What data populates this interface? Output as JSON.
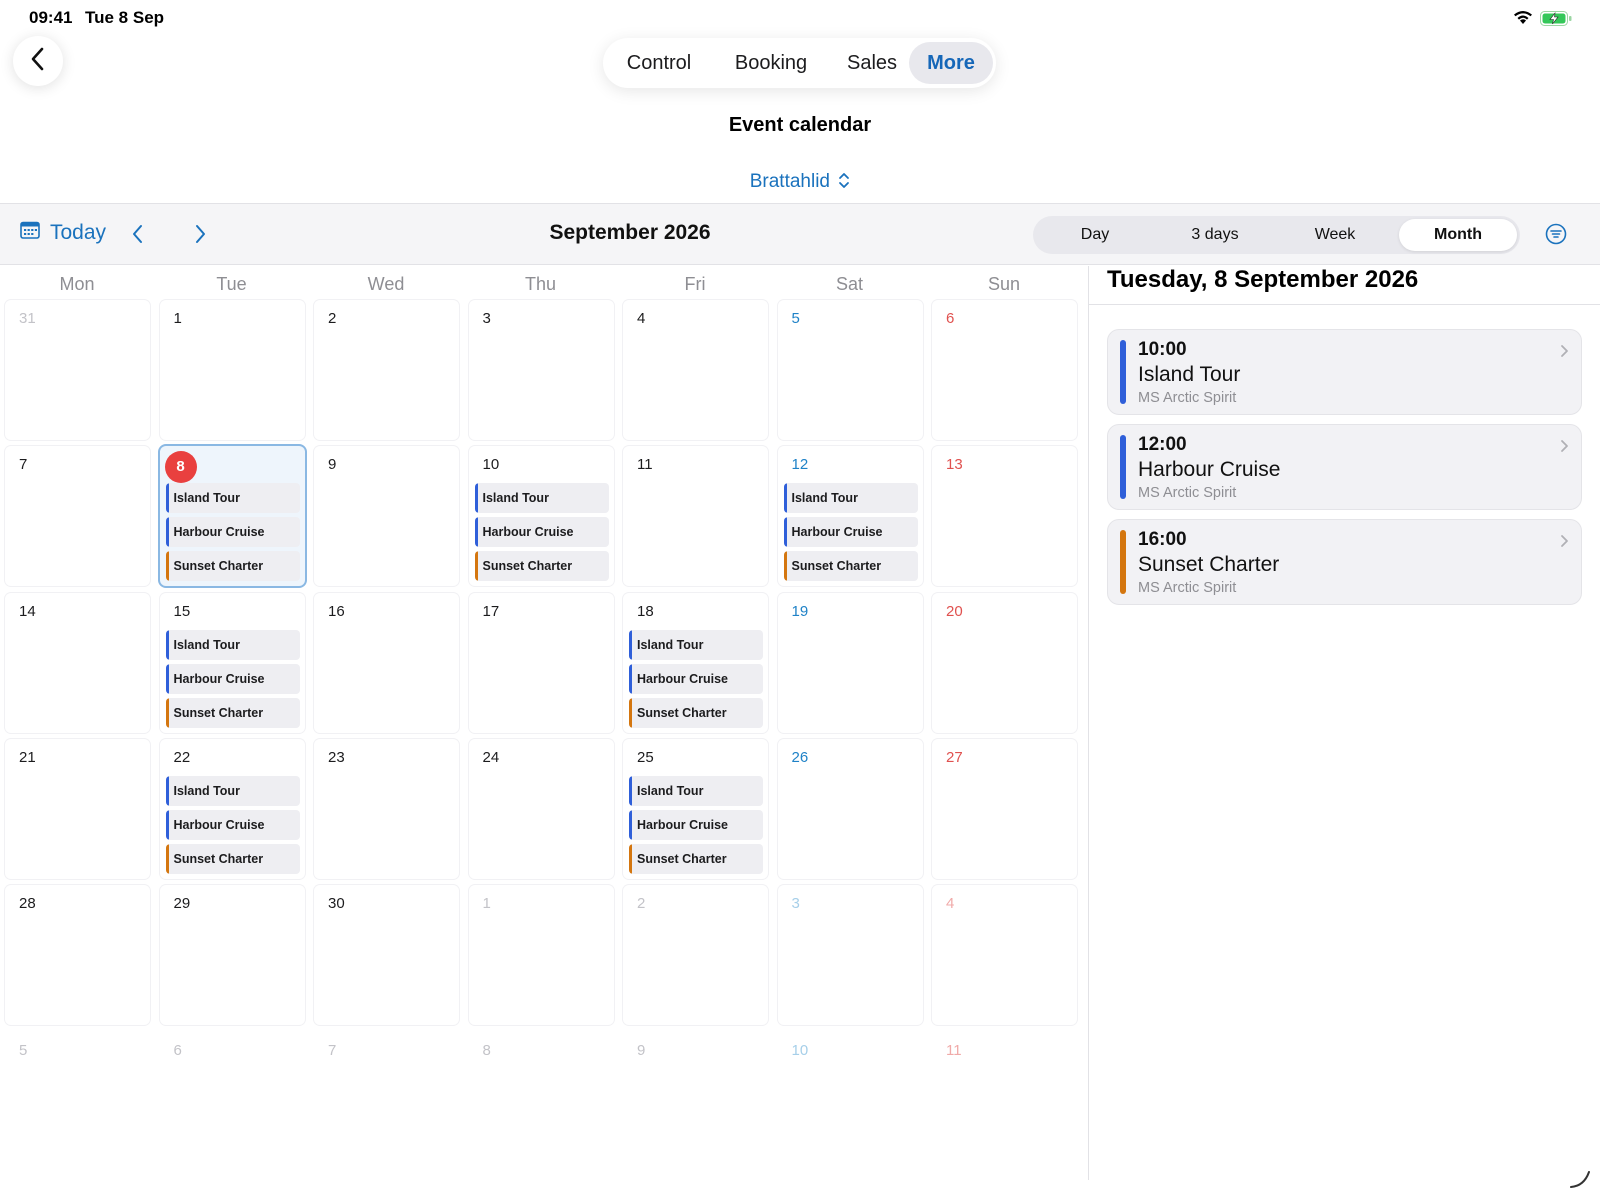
{
  "status_bar": {
    "time": "09:41",
    "date": "Tue 8 Sep",
    "wifi_icon": "wifi-icon",
    "battery_icon": "battery-charging-icon"
  },
  "header": {
    "back_icon": "chevron-left-icon",
    "tabs": [
      {
        "label": "Control",
        "active": false
      },
      {
        "label": "Booking",
        "active": false
      },
      {
        "label": "Sales",
        "active": false
      },
      {
        "label": "More",
        "active": true
      }
    ],
    "page_title": "Event calendar",
    "location": "Brattahlid",
    "location_icon": "chevron-up-down-icon"
  },
  "toolbar": {
    "today_label": "Today",
    "today_icon": "calendar-icon",
    "month_label": "September 2026",
    "views": [
      {
        "label": "Day",
        "active": false
      },
      {
        "label": "3 days",
        "active": false
      },
      {
        "label": "Week",
        "active": false
      },
      {
        "label": "Month",
        "active": true
      }
    ],
    "filter_icon": "filter-icon"
  },
  "calendar": {
    "weekdays": [
      "Mon",
      "Tue",
      "Wed",
      "Thu",
      "Fri",
      "Sat",
      "Sun"
    ],
    "weeks": [
      [
        {
          "day": "31",
          "dim": true,
          "events": []
        },
        {
          "day": "1",
          "events": []
        },
        {
          "day": "2",
          "events": []
        },
        {
          "day": "3",
          "events": []
        },
        {
          "day": "4",
          "events": []
        },
        {
          "day": "5",
          "events": []
        },
        {
          "day": "6",
          "events": []
        }
      ],
      [
        {
          "day": "7",
          "events": []
        },
        {
          "day": "8",
          "today": true,
          "events": [
            "Island Tour",
            "Harbour Cruise",
            "Sunset Charter"
          ]
        },
        {
          "day": "9",
          "events": []
        },
        {
          "day": "10",
          "events": [
            "Island Tour",
            "Harbour Cruise",
            "Sunset Charter"
          ]
        },
        {
          "day": "11",
          "events": []
        },
        {
          "day": "12",
          "events": [
            "Island Tour",
            "Harbour Cruise",
            "Sunset Charter"
          ]
        },
        {
          "day": "13",
          "events": []
        }
      ],
      [
        {
          "day": "14",
          "events": []
        },
        {
          "day": "15",
          "events": [
            "Island Tour",
            "Harbour Cruise",
            "Sunset Charter"
          ]
        },
        {
          "day": "16",
          "events": []
        },
        {
          "day": "17",
          "events": []
        },
        {
          "day": "18",
          "events": [
            "Island Tour",
            "Harbour Cruise",
            "Sunset Charter"
          ]
        },
        {
          "day": "19",
          "events": []
        },
        {
          "day": "20",
          "events": []
        }
      ],
      [
        {
          "day": "21",
          "events": []
        },
        {
          "day": "22",
          "events": [
            "Island Tour",
            "Harbour Cruise",
            "Sunset Charter"
          ]
        },
        {
          "day": "23",
          "events": []
        },
        {
          "day": "24",
          "events": []
        },
        {
          "day": "25",
          "events": [
            "Island Tour",
            "Harbour Cruise",
            "Sunset Charter"
          ]
        },
        {
          "day": "26",
          "events": []
        },
        {
          "day": "27",
          "events": []
        }
      ],
      [
        {
          "day": "28",
          "events": []
        },
        {
          "day": "29",
          "events": []
        },
        {
          "day": "30",
          "events": []
        },
        {
          "day": "1",
          "dim": true,
          "events": []
        },
        {
          "day": "2",
          "dim": true,
          "events": []
        },
        {
          "day": "3",
          "dim": true,
          "events": []
        },
        {
          "day": "4",
          "dim": true,
          "events": []
        }
      ],
      [
        {
          "day": "5",
          "dim": true,
          "events": []
        },
        {
          "day": "6",
          "dim": true,
          "events": []
        },
        {
          "day": "7",
          "dim": true,
          "events": []
        },
        {
          "day": "8",
          "dim": true,
          "events": []
        },
        {
          "day": "9",
          "dim": true,
          "events": []
        },
        {
          "day": "10",
          "dim": true,
          "events": []
        },
        {
          "day": "11",
          "dim": true,
          "events": []
        }
      ]
    ],
    "event_colors": {
      "Island Tour": "#2f5fd9",
      "Harbour Cruise": "#2f5fd9",
      "Sunset Charter": "#d4760f"
    }
  },
  "detail": {
    "title": "Tuesday, 8 September 2026",
    "events": [
      {
        "time": "10:00",
        "name": "Island Tour",
        "ship": "MS Arctic Spirit",
        "color": "#2f5fd9"
      },
      {
        "time": "12:00",
        "name": "Harbour Cruise",
        "ship": "MS Arctic Spirit",
        "color": "#2f5fd9"
      },
      {
        "time": "16:00",
        "name": "Sunset Charter",
        "ship": "MS Arctic Spirit",
        "color": "#d4760f"
      }
    ]
  },
  "colors": {
    "accent": "#1a72bd",
    "today_badge": "#e9403f",
    "saturday": "#1f82c7",
    "sunday": "#e0514f"
  }
}
